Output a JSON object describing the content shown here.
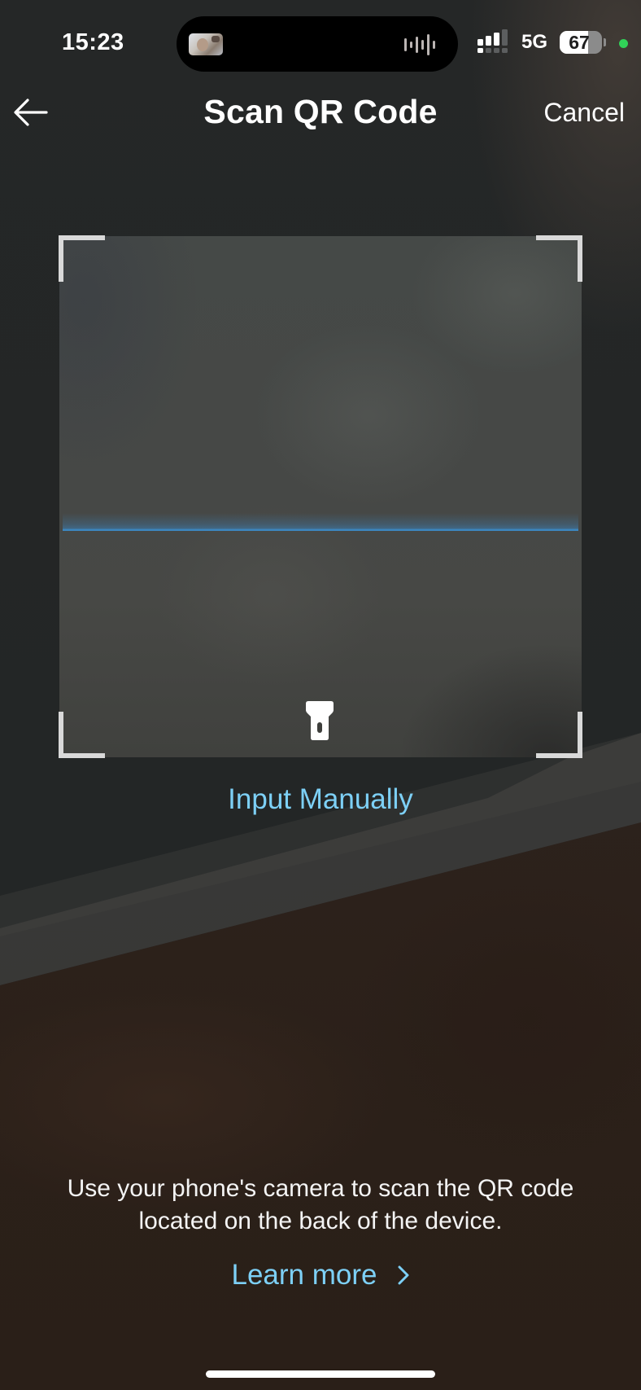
{
  "status_bar": {
    "time": "15:23",
    "network_type": "5G",
    "battery_percent": 67,
    "battery_label": "67",
    "signal_bars_sim1": 3,
    "signal_bars_sim2": 0,
    "mic_indicator_color": "#31d158",
    "live_activity": {
      "media_thumbnail": "video-thumbnail",
      "waveform_icon": "audio-waveform-icon"
    }
  },
  "header": {
    "back_icon": "arrow-left-icon",
    "title": "Scan QR Code",
    "cancel_label": "Cancel"
  },
  "scanner": {
    "flashlight_icon": "flashlight-icon",
    "scan_line_color": "#3c86bf",
    "input_manually_label": "Input Manually"
  },
  "footer": {
    "instruction": "Use your phone's camera to scan the QR code located on the back of the device.",
    "learn_more_label": "Learn more",
    "learn_more_icon": "chevron-right-icon"
  },
  "colors": {
    "accent": "#7dd0f6",
    "text_primary": "#ffffff"
  }
}
